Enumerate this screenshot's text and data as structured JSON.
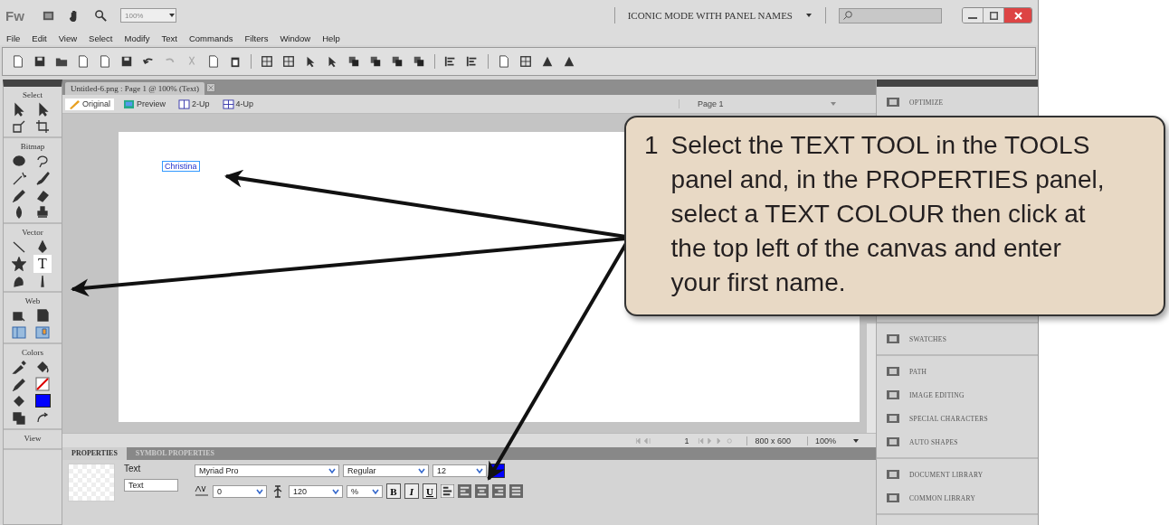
{
  "window": {
    "logo": "Fw",
    "zoom": "100%",
    "workspace": "ICONIC MODE WITH PANEL NAMES"
  },
  "menu": [
    "File",
    "Edit",
    "View",
    "Select",
    "Modify",
    "Text",
    "Commands",
    "Filters",
    "Window",
    "Help"
  ],
  "document": {
    "tab": "Untitled-6.png : Page 1 @ 100% (Text)",
    "views": [
      {
        "label": "Original",
        "selected": true
      },
      {
        "label": "Preview",
        "selected": false
      },
      {
        "label": "2-Up",
        "selected": false
      },
      {
        "label": "4-Up",
        "selected": false
      }
    ],
    "page": "Page 1",
    "canvas_text": "Christina",
    "frame": "1",
    "size": "800 x 600",
    "zoom": "100%"
  },
  "tool_sections": [
    {
      "label": "Select",
      "tools": [
        {
          "kind": "pointer",
          "selected": false
        },
        {
          "kind": "subselect",
          "selected": false
        },
        {
          "kind": "scale",
          "selected": false
        },
        {
          "kind": "crop",
          "selected": false
        }
      ]
    },
    {
      "label": "Bitmap",
      "tools": [
        {
          "kind": "marquee",
          "selected": false
        },
        {
          "kind": "lasso",
          "selected": false
        },
        {
          "kind": "wand",
          "selected": false
        },
        {
          "kind": "brush",
          "selected": false
        },
        {
          "kind": "pencil",
          "selected": false
        },
        {
          "kind": "eraser",
          "selected": false
        },
        {
          "kind": "blur",
          "selected": false
        },
        {
          "kind": "stamp",
          "selected": false
        }
      ]
    },
    {
      "label": "Vector",
      "tools": [
        {
          "kind": "line",
          "selected": false
        },
        {
          "kind": "pen",
          "selected": false
        },
        {
          "kind": "star",
          "selected": false
        },
        {
          "kind": "text",
          "glyph": "T",
          "selected": true
        },
        {
          "kind": "freeform",
          "selected": false
        },
        {
          "kind": "knife",
          "selected": false
        }
      ]
    },
    {
      "label": "Web",
      "tools": [
        {
          "kind": "hotspot",
          "selected": false
        },
        {
          "kind": "slice",
          "selected": false
        },
        {
          "kind": "hide-slices",
          "selected": false
        },
        {
          "kind": "show-slices",
          "selected": false
        }
      ]
    },
    {
      "label": "Colors",
      "tools": [
        {
          "kind": "eyedropper",
          "selected": false
        },
        {
          "kind": "bucket",
          "selected": false
        },
        {
          "kind": "stroke",
          "selected": false
        },
        {
          "kind": "no-stroke",
          "selected": false
        },
        {
          "kind": "fill-icon",
          "selected": false
        },
        {
          "kind": "fill-swatch",
          "color": "#0000ff",
          "selected": false
        },
        {
          "kind": "defaults",
          "selected": false
        },
        {
          "kind": "swap",
          "selected": false
        }
      ]
    },
    {
      "label": "View"
    }
  ],
  "properties": {
    "tabs": [
      {
        "label": "PROPERTIES",
        "selected": true
      },
      {
        "label": "SYMBOL PROPERTIES",
        "selected": false
      }
    ],
    "object_type": "Text",
    "name": "Text",
    "font": "Myriad Pro",
    "style": "Regular",
    "size": "12",
    "color": "#0000ff",
    "kerning": "0",
    "leading": "120",
    "leading_unit": "%",
    "format_buttons": [
      "B",
      "I",
      "U"
    ]
  },
  "panel_groups": [
    [
      "OPTIMIZE"
    ],
    [
      "SWATCHES"
    ],
    [
      "PATH",
      "IMAGE EDITING",
      "SPECIAL CHARACTERS",
      "AUTO SHAPES"
    ],
    [
      "DOCUMENT LIBRARY",
      "COMMON LIBRARY"
    ]
  ],
  "callout": {
    "number": "1",
    "text": "Select the TEXT TOOL in the TOOLS panel and, in the PROPERTIES panel, select a TEXT COLOUR then click at the top left of the canvas and enter your first name."
  }
}
